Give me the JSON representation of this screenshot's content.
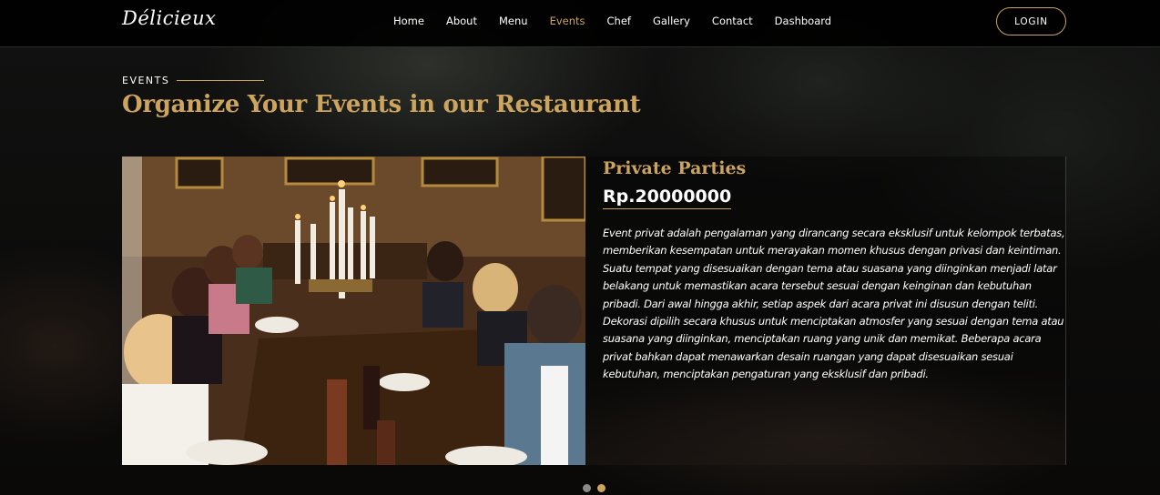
{
  "brand": {
    "logo": "Délicieux"
  },
  "nav": {
    "items": [
      {
        "label": "Home"
      },
      {
        "label": "About"
      },
      {
        "label": "Menu"
      },
      {
        "label": "Events",
        "active": true
      },
      {
        "label": "Chef"
      },
      {
        "label": "Gallery"
      },
      {
        "label": "Contact"
      },
      {
        "label": "Dashboard"
      }
    ],
    "login_label": "LOGIN"
  },
  "section": {
    "eyebrow": "EVENTS",
    "title": "Organize Your Events in our Restaurant"
  },
  "event": {
    "title": "Private Parties",
    "price": "Rp.20000000",
    "description": "Event privat adalah pengalaman yang dirancang secara eksklusif untuk kelompok terbatas, memberikan kesempatan untuk merayakan momen khusus dengan privasi dan keintiman. Suatu tempat yang disesuaikan dengan tema atau suasana yang diinginkan menjadi latar belakang untuk memastikan acara tersebut sesuai dengan keinginan dan kebutuhan pribadi. Dari awal hingga akhir, setiap aspek dari acara privat ini disusun dengan teliti. Dekorasi dipilih secara khusus untuk menciptakan atmosfer yang sesuai dengan tema atau suasana yang diinginkan, menciptakan ruang yang unik dan memikat. Beberapa acara privat bahkan dapat menawarkan desain ruangan yang dapat disesuaikan sesuai kebutuhan, menciptakan pengaturan yang eksklusif dan pribadi.",
    "image_icon": "dinner-party-photo"
  },
  "pagination": {
    "total": 2,
    "active_index": 2
  },
  "colors": {
    "accent": "#cda45e",
    "background": "#0b0b0b",
    "text": "#ffffff"
  }
}
